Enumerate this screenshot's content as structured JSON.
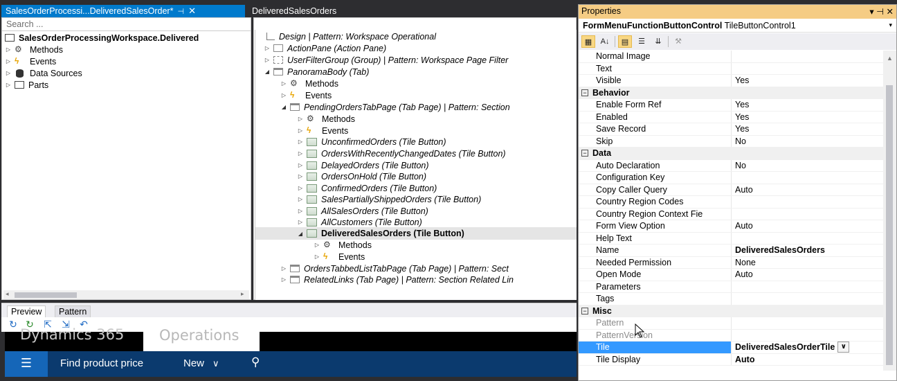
{
  "editor": {
    "tabs": [
      {
        "label": "SalesOrderProcessi...DeliveredSalesOrder*",
        "pin": "⊣",
        "close": "✕"
      },
      {
        "label": "DeliveredSalesOrders"
      }
    ],
    "search_placeholder": "Search ...",
    "left_tree": [
      {
        "label": "SalesOrderProcessingWorkspace.Delivered",
        "icon": "form-icon",
        "bold": true
      },
      {
        "label": "Methods",
        "icon": "methods-icon"
      },
      {
        "label": "Events",
        "icon": "events-icon"
      },
      {
        "label": "Data Sources",
        "icon": "datasource-icon"
      },
      {
        "label": "Parts",
        "icon": "parts-icon"
      }
    ],
    "design_tree": [
      {
        "label": "Design | Pattern: Workspace Operational",
        "icon": "design-icon"
      },
      {
        "label": "ActionPane (Action Pane)",
        "icon": "actionpane-icon"
      },
      {
        "label": "UserFilterGroup (Group) | Pattern: Workspace Page Filter",
        "icon": "group-icon"
      },
      {
        "label": "PanoramaBody (Tab)",
        "icon": "tab-icon"
      },
      {
        "label": "Methods",
        "icon": "methods-icon"
      },
      {
        "label": "Events",
        "icon": "events-icon"
      },
      {
        "label": "PendingOrdersTabPage (Tab Page) | Pattern: Section",
        "icon": "tabpage-icon"
      },
      {
        "label": "Methods",
        "icon": "methods-icon"
      },
      {
        "label": "Events",
        "icon": "events-icon"
      },
      {
        "label": "UnconfirmedOrders (Tile Button)",
        "icon": "tile-icon"
      },
      {
        "label": "OrdersWithRecentlyChangedDates (Tile Button)",
        "icon": "tile-icon"
      },
      {
        "label": "DelayedOrders (Tile Button)",
        "icon": "tile-icon"
      },
      {
        "label": "OrdersOnHold (Tile Button)",
        "icon": "tile-icon"
      },
      {
        "label": "ConfirmedOrders (Tile Button)",
        "icon": "tile-icon"
      },
      {
        "label": "SalesPartiallyShippedOrders (Tile Button)",
        "icon": "tile-icon"
      },
      {
        "label": "AllSalesOrders (Tile Button)",
        "icon": "tile-icon"
      },
      {
        "label": "AllCustomers (Tile Button)",
        "icon": "tile-icon"
      },
      {
        "label": "DeliveredSalesOrders (Tile Button)",
        "icon": "tile-icon"
      },
      {
        "label": "Methods",
        "icon": "methods-icon"
      },
      {
        "label": "Events",
        "icon": "events-icon"
      },
      {
        "label": "OrdersTabbedListTabPage (Tab Page) | Pattern: Sect",
        "icon": "tabpage-icon"
      },
      {
        "label": "RelatedLinks (Tab Page) | Pattern: Section Related Lin",
        "icon": "tabpage-icon"
      }
    ]
  },
  "preview": {
    "tabs": [
      "Preview",
      "Pattern"
    ],
    "brand": "Dynamics 365",
    "module": "Operations",
    "nav": {
      "menu_icon": "☰",
      "find": "Find product price",
      "new": "New",
      "new_chevron": "∨",
      "search_icon": "⚲"
    }
  },
  "properties": {
    "title": "Properties",
    "title_controls": "▾ ⊣ ✕",
    "object_type": "FormMenuFunctionButtonControl",
    "object_name": "TileButtonControl1",
    "rows": [
      {
        "name": "Normal Image",
        "value": ""
      },
      {
        "name": "Text",
        "value": ""
      },
      {
        "name": "Visible",
        "value": "Yes"
      },
      {
        "name": "Behavior",
        "category": true
      },
      {
        "name": "Enable Form Ref",
        "value": "Yes"
      },
      {
        "name": "Enabled",
        "value": "Yes"
      },
      {
        "name": "Save Record",
        "value": "Yes"
      },
      {
        "name": "Skip",
        "value": "No"
      },
      {
        "name": "Data",
        "category": true
      },
      {
        "name": "Auto Declaration",
        "value": "No"
      },
      {
        "name": "Configuration Key",
        "value": ""
      },
      {
        "name": "Copy Caller Query",
        "value": "Auto"
      },
      {
        "name": "Country Region Codes",
        "value": ""
      },
      {
        "name": "Country Region Context Fie",
        "value": ""
      },
      {
        "name": "Form View Option",
        "value": "Auto"
      },
      {
        "name": "Help Text",
        "value": ""
      },
      {
        "name": "Name",
        "value": "DeliveredSalesOrders"
      },
      {
        "name": "Needed Permission",
        "value": "None"
      },
      {
        "name": "Open Mode",
        "value": "Auto"
      },
      {
        "name": "Parameters",
        "value": ""
      },
      {
        "name": "Tags",
        "value": ""
      },
      {
        "name": "Misc",
        "category": true
      },
      {
        "name": "Pattern",
        "value": ""
      },
      {
        "name": "PatternVersion",
        "value": ""
      },
      {
        "name": "Tile",
        "value": "DeliveredSalesOrderTile"
      },
      {
        "name": "Tile Display",
        "value": "Auto"
      }
    ]
  }
}
